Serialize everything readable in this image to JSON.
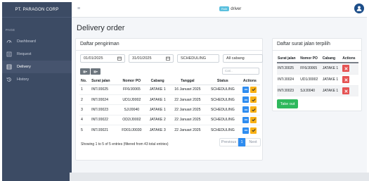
{
  "sidebar": {
    "brand": "PT. PARAGON CORP",
    "section_title": "PAGE",
    "items": [
      {
        "label": "Dashboard",
        "icon": "speedometer-icon"
      },
      {
        "label": "Request",
        "icon": "list-icon"
      },
      {
        "label": "Delivery",
        "icon": "grid-icon"
      },
      {
        "label": "History",
        "icon": "history-icon"
      }
    ],
    "active_index": 2
  },
  "header": {
    "role_badge": "Role",
    "role_text": "driver"
  },
  "page": {
    "title": "Delivery order"
  },
  "pengiriman": {
    "title": "Daftar pengiriman",
    "filters": {
      "date_from": "01/01/2025",
      "date_to": "31/01/2025",
      "status": "SCHEDULING",
      "cabang": "All cabang"
    },
    "search_placeholder": "Cari..",
    "columns": [
      "No.",
      "Surat jalan",
      "Nomor PO",
      "Cabang",
      "Tanggal",
      "Status",
      "Actions"
    ],
    "rows": [
      {
        "no": "1",
        "surat_jalan": "INT/J0025",
        "nomor_po": "FF6/J0065",
        "cabang": "JATAKE 1",
        "tanggal": "16 Januari 2025",
        "status": "SCHEDULING"
      },
      {
        "no": "2",
        "surat_jalan": "INT/J0024",
        "nomor_po": "UD1/J0002",
        "cabang": "JATAKE 1",
        "tanggal": "22 Januari 2025",
        "status": "SCHEDULING"
      },
      {
        "no": "3",
        "surat_jalan": "INT/J0023",
        "nomor_po": "SJ/J0040",
        "cabang": "JATAKE 1",
        "tanggal": "22 Januari 2025",
        "status": "SCHEDULING"
      },
      {
        "no": "4",
        "surat_jalan": "INT/J0022",
        "nomor_po": "OD2/J0002",
        "cabang": "JATAKE 2",
        "tanggal": "22 Januari 2025",
        "status": "SCHEDULING"
      },
      {
        "no": "5",
        "surat_jalan": "INT/J0021",
        "nomor_po": "FD01/J0030",
        "cabang": "JATAKE 3",
        "tanggal": "22 Januari 2025",
        "status": "SCHEDULING"
      }
    ],
    "entries_text": "Showing 1 to 5 of 5 entries (filtered from 43 total entries)",
    "pager": {
      "prev": "Previous",
      "current": "1",
      "next": "Next"
    }
  },
  "selected": {
    "title": "Daftar surat jalan terpilih",
    "columns": [
      "Surat jalan",
      "Nomor PO",
      "Cabang",
      "Actions"
    ],
    "rows": [
      {
        "surat_jalan": "INT/J0025",
        "nomor_po": "FF6/J0065",
        "cabang": "JATAKE 1"
      },
      {
        "surat_jalan": "INT/J0024",
        "nomor_po": "UD1/J0002",
        "cabang": "JATAKE 1"
      },
      {
        "surat_jalan": "INT/J0023",
        "nomor_po": "SJ/J0040",
        "cabang": "JATAKE 1"
      }
    ],
    "take_out_label": "Take out"
  },
  "colors": {
    "sidebar": "#3c4b64",
    "primary": "#2e8cf0",
    "warning": "#f9b115",
    "danger": "#e55353",
    "success": "#2eb85c",
    "info": "#5bc0de"
  }
}
